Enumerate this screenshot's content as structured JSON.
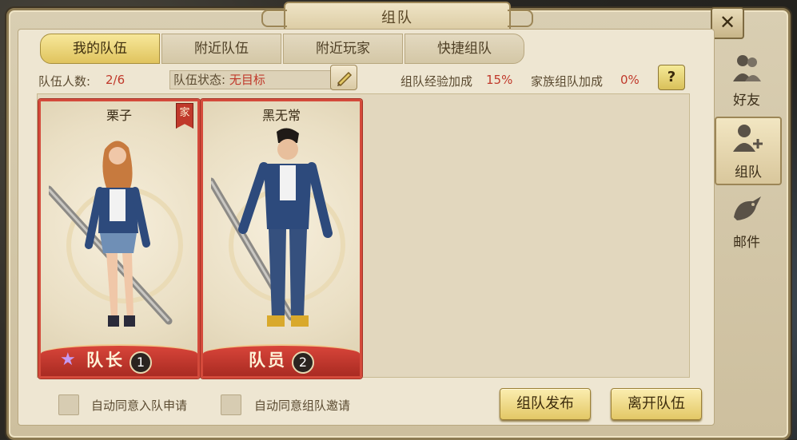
{
  "window": {
    "title": "组队",
    "close_label": "✕"
  },
  "tabs": [
    {
      "label": "我的队伍",
      "active": true
    },
    {
      "label": "附近队伍",
      "active": false
    },
    {
      "label": "附近玩家",
      "active": false
    },
    {
      "label": "快捷组队",
      "active": false
    }
  ],
  "info": {
    "member_count_label": "队伍人数:",
    "member_count_value": "2/6",
    "status_label": "队伍状态:",
    "status_value": "无目标",
    "exp_bonus_label": "组队经验加成",
    "exp_bonus_value": "15%",
    "family_bonus_label": "家族组队加成",
    "family_bonus_value": "0%",
    "help_label": "?"
  },
  "members": [
    {
      "name": "栗子",
      "badge": "家",
      "role": "队长",
      "number": "1",
      "leader_star": "★"
    },
    {
      "name": "黑无常",
      "role": "队员",
      "number": "2"
    }
  ],
  "options": {
    "auto_accept_apply": "自动同意入队申请",
    "auto_accept_invite": "自动同意组队邀请"
  },
  "buttons": {
    "publish": "组队发布",
    "leave": "离开队伍"
  },
  "side_tabs": [
    {
      "label": "好友",
      "icon": "friends-icon"
    },
    {
      "label": "组队",
      "icon": "team-icon",
      "active": true
    },
    {
      "label": "邮件",
      "icon": "mail-icon"
    }
  ],
  "colors": {
    "accent_red": "#c0392b",
    "gold": "#e3c866"
  }
}
